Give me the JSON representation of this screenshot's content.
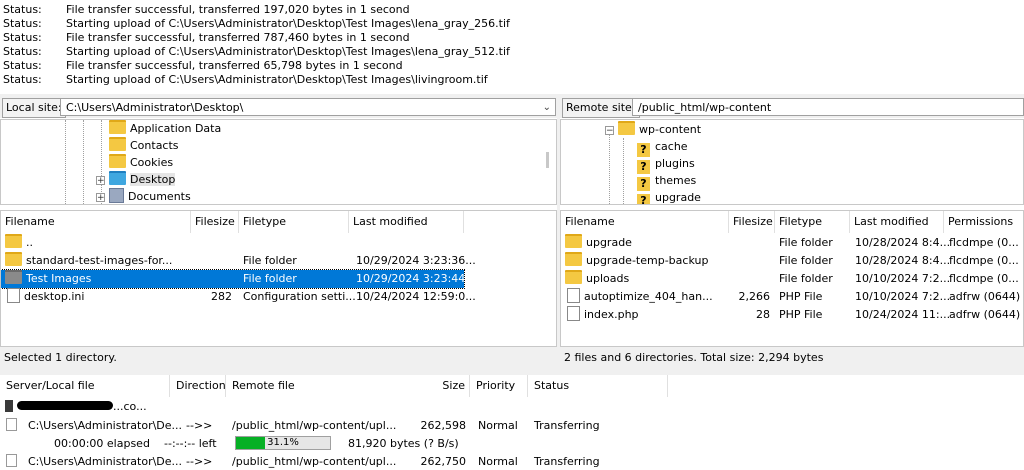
{
  "log": [
    {
      "label": "Status:",
      "text": "File transfer successful, transferred 197,020 bytes in 1 second"
    },
    {
      "label": "Status:",
      "text": "Starting upload of C:\\Users\\Administrator\\Desktop\\Test Images\\lena_gray_256.tif"
    },
    {
      "label": "Status:",
      "text": "File transfer successful, transferred 787,460 bytes in 1 second"
    },
    {
      "label": "Status:",
      "text": "Starting upload of C:\\Users\\Administrator\\Desktop\\Test Images\\lena_gray_512.tif"
    },
    {
      "label": "Status:",
      "text": "File transfer successful, transferred 65,798 bytes in 1 second"
    },
    {
      "label": "Status:",
      "text": "Starting upload of C:\\Users\\Administrator\\Desktop\\Test Images\\livingroom.tif"
    }
  ],
  "local": {
    "label": "Local site:",
    "path": "C:\\Users\\Administrator\\Desktop\\",
    "tree": [
      {
        "name": "Application Data",
        "icon": "folder-icon"
      },
      {
        "name": "Contacts",
        "icon": "folder-icon"
      },
      {
        "name": "Cookies",
        "icon": "folder-icon"
      },
      {
        "name": "Desktop",
        "icon": "desktop-folder-icon"
      },
      {
        "name": "Documents",
        "icon": "documents-icon"
      }
    ],
    "columns": {
      "filename": "Filename",
      "filesize": "Filesize",
      "filetype": "Filetype",
      "modified": "Last modified"
    },
    "files": [
      {
        "name": "..",
        "size": "",
        "type": "",
        "modified": ""
      },
      {
        "name": "standard-test-images-for...",
        "size": "",
        "type": "File folder",
        "modified": "10/29/2024 3:23:36..."
      },
      {
        "name": "Test Images",
        "size": "",
        "type": "File folder",
        "modified": "10/29/2024 3:23:44..."
      },
      {
        "name": "desktop.ini",
        "size": "282",
        "type": "Configuration setti...",
        "modified": "10/24/2024 12:59:0..."
      }
    ],
    "status": "Selected 1 directory."
  },
  "remote": {
    "label": "Remote site:",
    "path": "/public_html/wp-content",
    "tree": [
      {
        "name": "wp-content",
        "icon": "folder-icon"
      },
      {
        "name": "cache",
        "icon": "unknown-folder-icon"
      },
      {
        "name": "plugins",
        "icon": "unknown-folder-icon"
      },
      {
        "name": "themes",
        "icon": "unknown-folder-icon"
      },
      {
        "name": "upgrade",
        "icon": "unknown-folder-icon"
      }
    ],
    "columns": {
      "filename": "Filename",
      "filesize": "Filesize",
      "filetype": "Filetype",
      "modified": "Last modified",
      "permissions": "Permissions"
    },
    "files": [
      {
        "name": "upgrade",
        "size": "",
        "type": "File folder",
        "modified": "10/28/2024 8:4...",
        "perm": "flcdmpe (0..."
      },
      {
        "name": "upgrade-temp-backup",
        "size": "",
        "type": "File folder",
        "modified": "10/28/2024 8:4...",
        "perm": "flcdmpe (0..."
      },
      {
        "name": "uploads",
        "size": "",
        "type": "File folder",
        "modified": "10/10/2024 7:2...",
        "perm": "flcdmpe (0..."
      },
      {
        "name": "autoptimize_404_han...",
        "size": "2,266",
        "type": "PHP File",
        "modified": "10/10/2024 7:2...",
        "perm": "adfrw (0644)"
      },
      {
        "name": "index.php",
        "size": "28",
        "type": "PHP File",
        "modified": "10/24/2024 11:...",
        "perm": "adfrw (0644)"
      }
    ],
    "status": "2 files and 6 directories. Total size: 2,294 bytes"
  },
  "queue": {
    "columns": {
      "server": "Server/Local file",
      "direction": "Direction",
      "remote": "Remote file",
      "size": "Size",
      "priority": "Priority",
      "status": "Status"
    },
    "server_suffix": "...co...",
    "rows": [
      {
        "local": "C:\\Users\\Administrator\\De...",
        "dir": "-->>",
        "remote": "/public_html/wp-content/upl...",
        "size": "262,598",
        "priority": "Normal",
        "status": "Transferring"
      },
      {
        "local": "C:\\Users\\Administrator\\De...",
        "dir": "-->>",
        "remote": "/public_html/wp-content/upl...",
        "size": "262,750",
        "priority": "Normal",
        "status": "Transferring"
      }
    ],
    "progress": {
      "elapsed": "00:00:00 elapsed",
      "left": "--:--:-- left",
      "percent_label": "31.1%",
      "percent": 31.1,
      "bytes": "81,920 bytes (? B/s)"
    }
  }
}
